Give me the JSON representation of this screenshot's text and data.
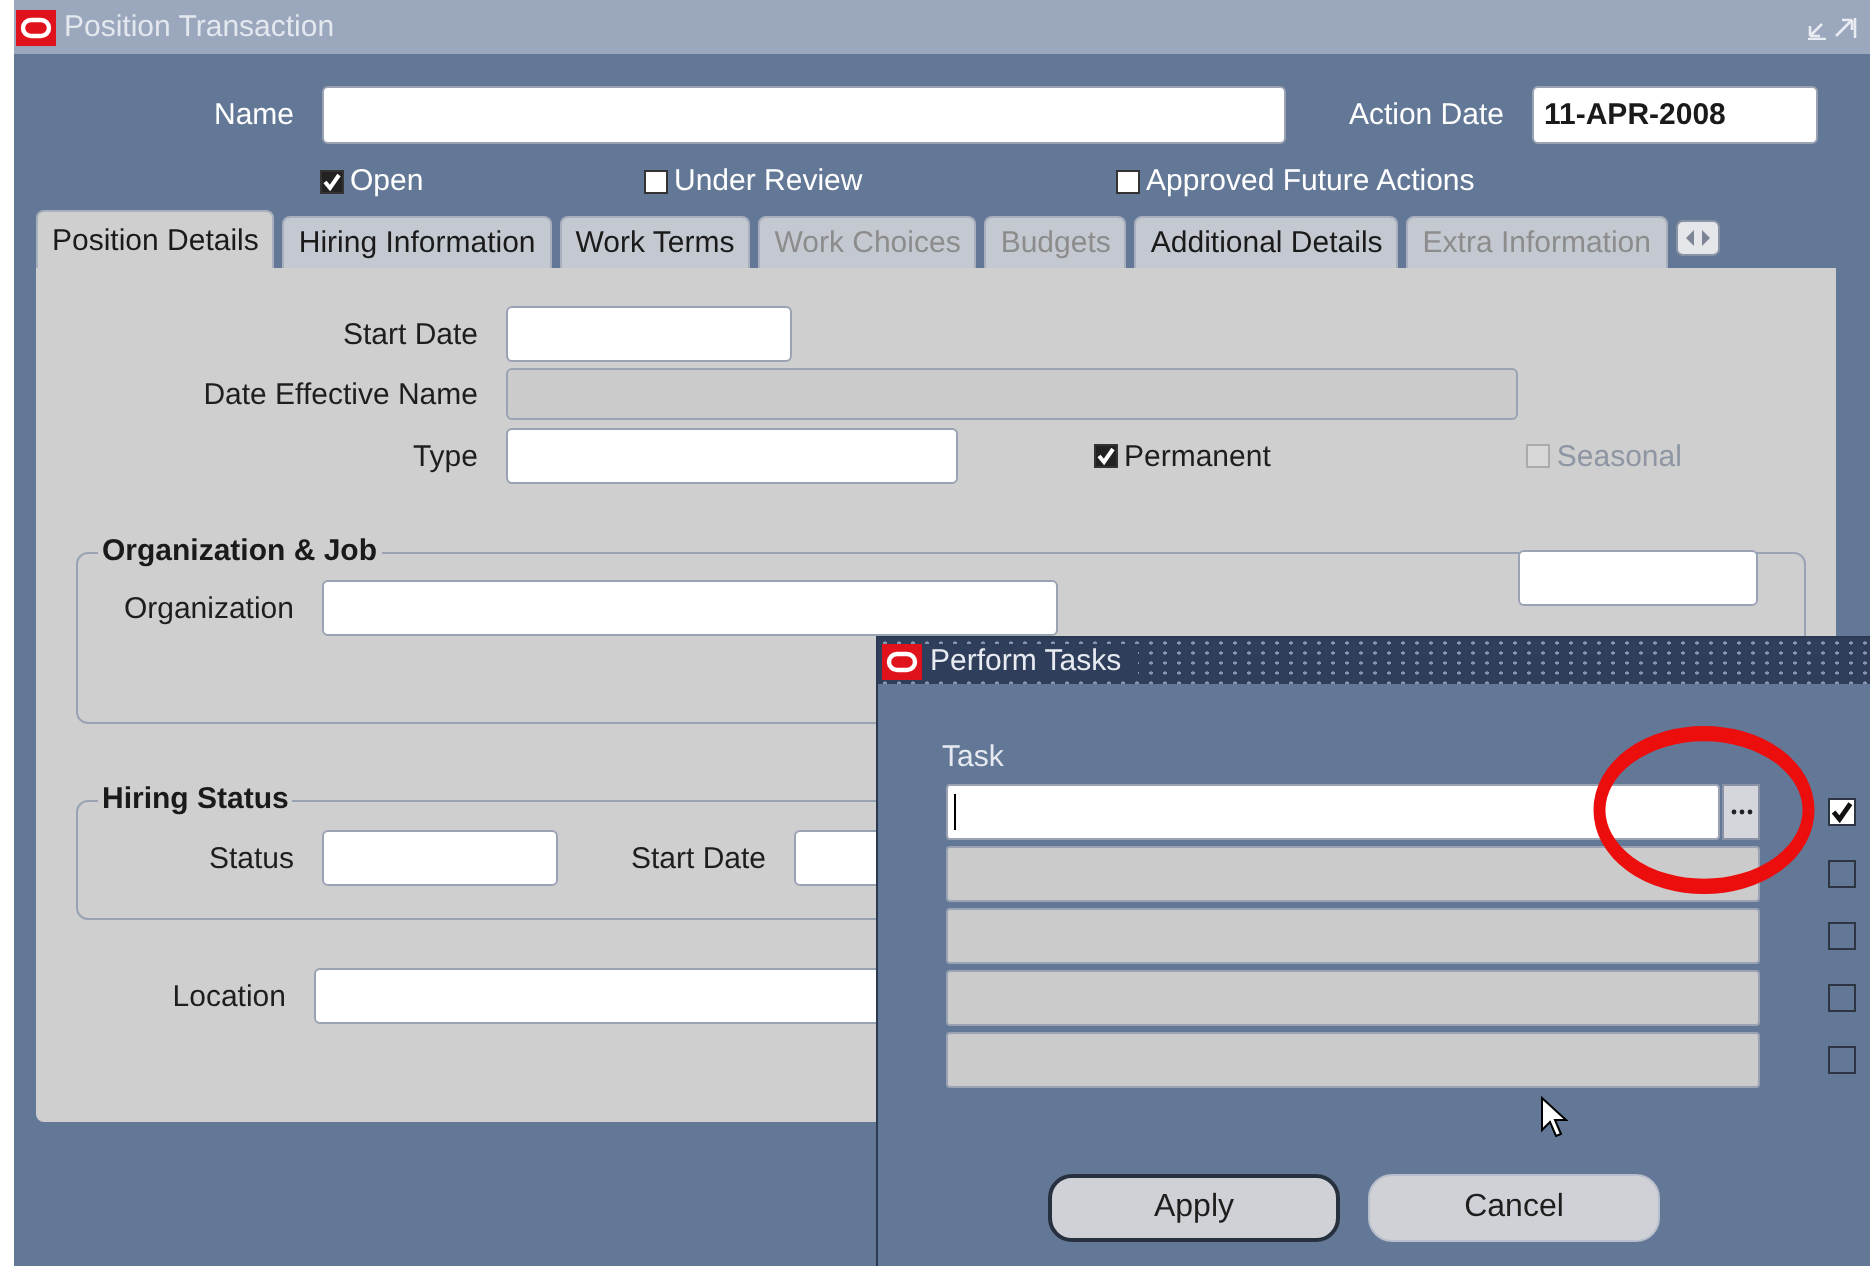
{
  "window": {
    "title": "Position Transaction"
  },
  "header": {
    "name": {
      "label": "Name"
    },
    "action_date": {
      "label": "Action Date",
      "value": "11-APR-2008"
    }
  },
  "flags": [
    {
      "label": "Open",
      "checked": true
    },
    {
      "label": "Under Review",
      "checked": false
    },
    {
      "label": "Approved Future Actions",
      "checked": false
    }
  ],
  "tabs": [
    {
      "label": "Position Details",
      "selected": true,
      "disabled": false
    },
    {
      "label": "Hiring Information",
      "selected": false,
      "disabled": false
    },
    {
      "label": "Work Terms",
      "selected": false,
      "disabled": false
    },
    {
      "label": "Work Choices",
      "selected": false,
      "disabled": true
    },
    {
      "label": "Budgets",
      "selected": false,
      "disabled": true
    },
    {
      "label": "Additional Details",
      "selected": false,
      "disabled": false
    },
    {
      "label": "Extra Information",
      "selected": false,
      "disabled": true
    }
  ],
  "details": {
    "start_date": {
      "label": "Start Date"
    },
    "date_effective_name": {
      "label": "Date Effective Name",
      "disabled": true
    },
    "type": {
      "label": "Type"
    },
    "options": [
      {
        "label": "Permanent",
        "checked": true,
        "disabled": false
      },
      {
        "label": "Seasonal",
        "checked": false,
        "disabled": true
      }
    ]
  },
  "organization_job": {
    "title": "Organization & Job",
    "organization_label": "Organization"
  },
  "hiring_status": {
    "title": "Hiring Status",
    "status_label": "Status",
    "start_date_label": "Start Date"
  },
  "location": {
    "label": "Location"
  },
  "dialog": {
    "title": "Perform Tasks",
    "column": "Task",
    "rows": [
      {
        "active": true,
        "enabled": true
      },
      {
        "active": false,
        "enabled": false
      },
      {
        "active": false,
        "enabled": false
      },
      {
        "active": false,
        "enabled": false
      },
      {
        "active": false,
        "enabled": false
      }
    ],
    "buttons": [
      {
        "label": "Apply",
        "default": true
      },
      {
        "label": "Cancel",
        "default": false
      }
    ]
  }
}
